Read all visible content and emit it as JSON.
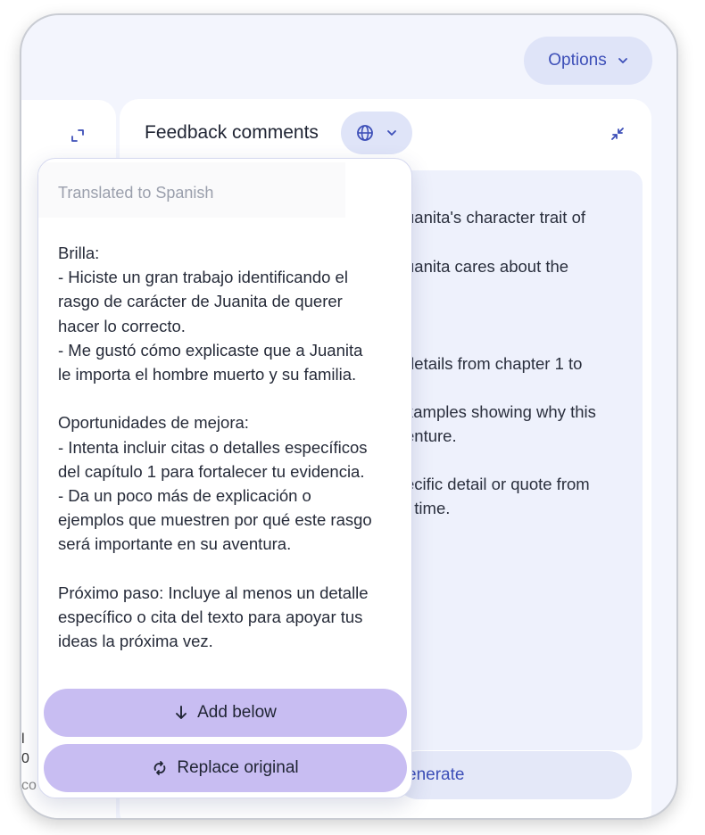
{
  "header": {
    "options_label": "Options"
  },
  "left_panel": {
    "edge_chars": [
      "l",
      "0",
      "co"
    ]
  },
  "feedback": {
    "title": "Feedback comments",
    "background_lines": [
      "uanita's character trait of",
      "uanita cares about the",
      "details from chapter 1 to",
      "xamples showing why this",
      "enture.",
      "ecific detail or quote from",
      "t time."
    ],
    "regenerate_label": "enerate"
  },
  "translation_popup": {
    "label": "Translated to Spanish",
    "lines": [
      "Brilla:",
      "- Hiciste un gran trabajo identificando el",
      "rasgo de carácter de Juanita de querer",
      "hacer lo correcto.",
      "- Me gustó cómo explicaste que a Juanita",
      "le importa el hombre muerto y su familia.",
      "",
      "Oportunidades de mejora:",
      "- Intenta incluir citas o detalles específicos",
      "del capítulo 1 para fortalecer tu evidencia.",
      "- Da un poco más de explicación o",
      "ejemplos que muestren por qué este rasgo",
      "será importante en su aventura.",
      "",
      "Próximo paso: Incluye al menos un detalle",
      "específico o cita del texto para apoyar tus",
      "ideas la próxima vez."
    ],
    "add_below_label": "Add below",
    "replace_label": "Replace original"
  },
  "colors": {
    "accent": "#3d4fb8",
    "pill_purple": "#c8bdf2",
    "soft_blue": "#dfe4f8"
  },
  "icons": [
    "chevron-down-icon",
    "globe-icon",
    "expand-icon",
    "collapse-icon",
    "arrow-down-icon",
    "swap-icon"
  ]
}
